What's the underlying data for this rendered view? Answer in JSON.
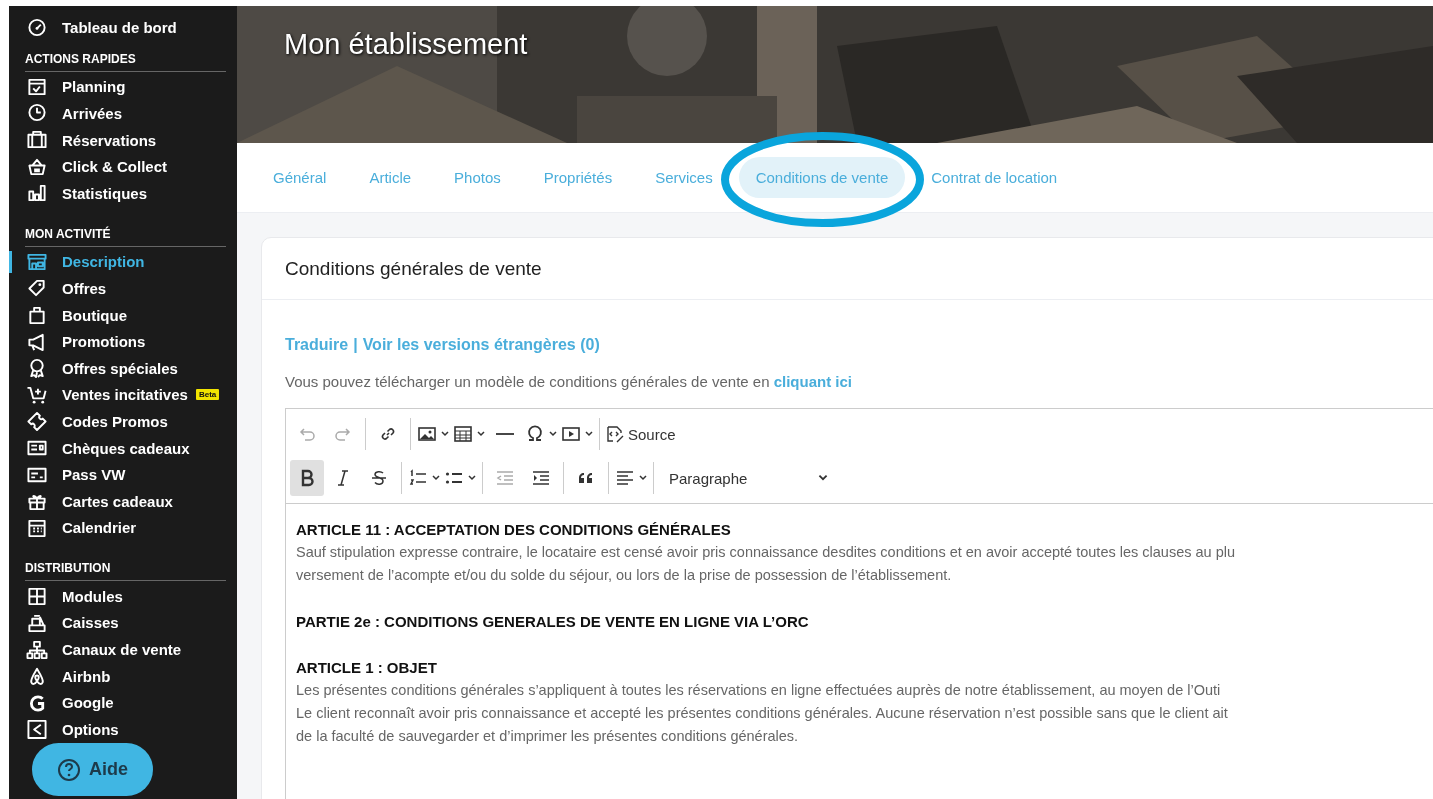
{
  "sidebar": {
    "top_item": {
      "label": "Tableau de bord",
      "selected": false
    },
    "sections": [
      {
        "heading": "ACTIONS RAPIDES",
        "items": [
          {
            "label": "Planning",
            "selected": false
          },
          {
            "label": "Arrivées",
            "selected": false
          },
          {
            "label": "Réservations",
            "selected": false
          },
          {
            "label": "Click & Collect",
            "selected": false
          },
          {
            "label": "Statistiques",
            "selected": false
          }
        ]
      },
      {
        "heading": "MON ACTIVITÉ",
        "items": [
          {
            "label": "Description",
            "selected": true
          },
          {
            "label": "Offres",
            "selected": false
          },
          {
            "label": "Boutique",
            "selected": false
          },
          {
            "label": "Promotions",
            "selected": false
          },
          {
            "label": "Offres spéciales",
            "selected": false
          },
          {
            "label": "Ventes incitatives",
            "selected": false,
            "badge": "Beta"
          },
          {
            "label": "Codes Promos",
            "selected": false
          },
          {
            "label": "Chèques cadeaux",
            "selected": false
          },
          {
            "label": "Pass VW",
            "selected": false
          },
          {
            "label": "Cartes cadeaux",
            "selected": false
          },
          {
            "label": "Calendrier",
            "selected": false
          }
        ]
      },
      {
        "heading": "DISTRIBUTION",
        "items": [
          {
            "label": "Modules",
            "selected": false
          },
          {
            "label": "Caisses",
            "selected": false
          },
          {
            "label": "Canaux de vente",
            "selected": false
          },
          {
            "label": "Airbnb",
            "selected": false
          },
          {
            "label": "Google",
            "selected": false
          },
          {
            "label": "Options",
            "selected": false
          }
        ]
      }
    ]
  },
  "help_button": {
    "label": "Aide"
  },
  "header": {
    "title": "Mon établissement"
  },
  "tabs": [
    {
      "label": "Général",
      "selected": false
    },
    {
      "label": "Article",
      "selected": false
    },
    {
      "label": "Photos",
      "selected": false
    },
    {
      "label": "Propriétés",
      "selected": false
    },
    {
      "label": "Services",
      "selected": false
    },
    {
      "label": "Conditions de vente",
      "selected": true
    },
    {
      "label": "Contrat de location",
      "selected": false
    }
  ],
  "annotation_ellipse": true,
  "card": {
    "title": "Conditions générales de vente",
    "links": [
      {
        "label": "Traduire"
      },
      {
        "label": "Voir les versions étrangères (0)"
      }
    ],
    "link_separator": "|",
    "intro": "Vous pouvez télécharger un modèle de conditions générales de vente en ",
    "intro_link": "cliquant ici",
    "toolbar": {
      "undo_disabled": true,
      "redo_disabled": true,
      "outdent_disabled": true,
      "bold_on": true,
      "source_label": "Source",
      "format": "Paragraphe"
    },
    "content": [
      {
        "kind": "heading",
        "text": "ARTICLE 11 : ACCEPTATION DES CONDITIONS GÉNÉRALES"
      },
      {
        "kind": "paragraph",
        "lines": [
          "Sauf stipulation expresse contraire, le locataire est censé avoir pris connaissance desdites conditions et en avoir accepté toutes les clauses au plu",
          "versement de l’acompte et/ou du solde du séjour, ou lors de la prise de possession de l’établissement."
        ]
      },
      {
        "kind": "blank"
      },
      {
        "kind": "heading",
        "text": "PARTIE 2e : CONDITIONS GENERALES DE VENTE EN LIGNE VIA L’ORC"
      },
      {
        "kind": "blank"
      },
      {
        "kind": "heading",
        "text": "ARTICLE 1 : OBJET"
      },
      {
        "kind": "paragraph",
        "lines": [
          "Les présentes conditions générales s’appliquent à toutes les réservations en ligne effectuées auprès de notre établissement, au moyen de l’Outi",
          "Le client reconnaît avoir pris connaissance et accepté les présentes conditions générales. Aucune réservation n’est possible sans que le client ait",
          "de la faculté de sauvegarder et d’imprimer les présentes conditions générales."
        ]
      }
    ]
  }
}
